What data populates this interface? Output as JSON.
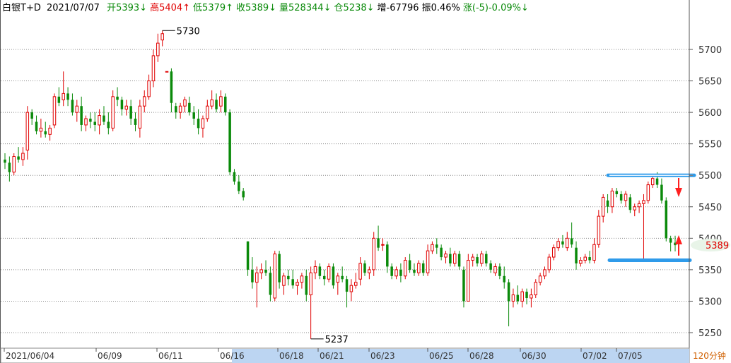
{
  "header": {
    "symbol": "白银T+D",
    "date": "2021/07/07",
    "items": [
      {
        "label": "开",
        "value": "5393",
        "arrow": "↓",
        "color": "#0a8a0a"
      },
      {
        "label": "高",
        "value": "5404",
        "arrow": "↑",
        "color": "#e00000"
      },
      {
        "label": "低",
        "value": "5379",
        "arrow": "↑",
        "color": "#0a8a0a"
      },
      {
        "label": "收",
        "value": "5389",
        "arrow": "↓",
        "color": "#0a8a0a"
      },
      {
        "label": "量",
        "value": "528344",
        "arrow": "↓",
        "color": "#0a8a0a"
      },
      {
        "label": "仓",
        "value": "5238",
        "arrow": "↓",
        "color": "#0a8a0a"
      },
      {
        "label": "增",
        "value": "-67796",
        "arrow": "",
        "color": "#000000"
      },
      {
        "label": "振",
        "value": "0.46%",
        "arrow": "",
        "color": "#000000"
      },
      {
        "label": "涨",
        "value": "(-5)-0.09%",
        "arrow": "↓",
        "color": "#0a8a0a"
      }
    ]
  },
  "chart_data": {
    "type": "candlestick",
    "period": "120分钟",
    "ylim": [
      5215,
      5745
    ],
    "y_ticks": [
      5250,
      5300,
      5350,
      5400,
      5450,
      5500,
      5550,
      5600,
      5650,
      5700
    ],
    "x_tick_labels": [
      "2021/06/04",
      "06/09",
      "06/11",
      "06/16",
      "06/18",
      "06/21",
      "06/23",
      "06/25",
      "06/28",
      "06/30",
      "07/02",
      "07/05"
    ],
    "last_price": "5389",
    "annotations": {
      "high": "5730",
      "low": "5237"
    },
    "resistance_level": 5500,
    "support_level": 5365,
    "colors": {
      "up": "#e00000",
      "down": "#0a8a0a",
      "level_line": "#2f9bea",
      "arrow": "#ff2020"
    },
    "candles": [
      [
        5525,
        5535,
        5510,
        5520
      ],
      [
        5520,
        5530,
        5490,
        5505
      ],
      [
        5505,
        5535,
        5500,
        5530
      ],
      [
        5530,
        5545,
        5520,
        5525
      ],
      [
        5525,
        5545,
        5515,
        5535
      ],
      [
        5540,
        5610,
        5525,
        5600
      ],
      [
        5600,
        5605,
        5580,
        5590
      ],
      [
        5585,
        5595,
        5565,
        5570
      ],
      [
        5570,
        5590,
        5560,
        5575
      ],
      [
        5570,
        5585,
        5560,
        5565
      ],
      [
        5565,
        5580,
        5555,
        5575
      ],
      [
        5580,
        5630,
        5575,
        5625
      ],
      [
        5625,
        5640,
        5610,
        5615
      ],
      [
        5620,
        5665,
        5610,
        5630
      ],
      [
        5630,
        5640,
        5610,
        5620
      ],
      [
        5620,
        5630,
        5595,
        5600
      ],
      [
        5600,
        5620,
        5585,
        5610
      ],
      [
        5610,
        5625,
        5570,
        5580
      ],
      [
        5580,
        5595,
        5570,
        5590
      ],
      [
        5590,
        5600,
        5575,
        5585
      ],
      [
        5585,
        5600,
        5570,
        5580
      ],
      [
        5580,
        5605,
        5565,
        5595
      ],
      [
        5595,
        5610,
        5580,
        5585
      ],
      [
        5585,
        5600,
        5565,
        5575
      ],
      [
        5575,
        5635,
        5570,
        5625
      ],
      [
        5625,
        5640,
        5610,
        5620
      ],
      [
        5620,
        5625,
        5595,
        5605
      ],
      [
        5605,
        5620,
        5595,
        5610
      ],
      [
        5610,
        5620,
        5580,
        5590
      ],
      [
        5590,
        5600,
        5570,
        5580
      ],
      [
        5575,
        5620,
        5560,
        5610
      ],
      [
        5610,
        5635,
        5600,
        5625
      ],
      [
        5625,
        5660,
        5620,
        5650
      ],
      [
        5650,
        5700,
        5640,
        5690
      ],
      [
        5690,
        5725,
        5680,
        5710
      ],
      [
        5715,
        5730,
        5705,
        5725
      ],
      [
        5665,
        5665,
        5665,
        5665
      ],
      [
        5665,
        5670,
        5600,
        5615
      ],
      [
        5610,
        5615,
        5590,
        5600
      ],
      [
        5600,
        5615,
        5590,
        5610
      ],
      [
        5610,
        5625,
        5600,
        5620
      ],
      [
        5615,
        5625,
        5595,
        5600
      ],
      [
        5600,
        5610,
        5580,
        5590
      ],
      [
        5590,
        5605,
        5565,
        5575
      ],
      [
        5575,
        5595,
        5560,
        5590
      ],
      [
        5590,
        5620,
        5585,
        5610
      ],
      [
        5610,
        5635,
        5605,
        5620
      ],
      [
        5620,
        5630,
        5600,
        5605
      ],
      [
        5610,
        5635,
        5600,
        5625
      ],
      [
        5625,
        5630,
        5595,
        5600
      ],
      [
        5600,
        5605,
        5500,
        5505
      ],
      [
        5505,
        5510,
        5485,
        5490
      ],
      [
        5490,
        5500,
        5470,
        5475
      ],
      [
        5475,
        5480,
        5460,
        5465
      ],
      [
        5395,
        5395,
        5340,
        5350
      ],
      [
        5350,
        5370,
        5320,
        5330
      ],
      [
        5330,
        5355,
        5290,
        5345
      ],
      [
        5345,
        5360,
        5335,
        5350
      ],
      [
        5350,
        5365,
        5340,
        5345
      ],
      [
        5345,
        5355,
        5300,
        5310
      ],
      [
        5305,
        5380,
        5300,
        5375
      ],
      [
        5375,
        5380,
        5320,
        5330
      ],
      [
        5325,
        5345,
        5310,
        5340
      ],
      [
        5340,
        5350,
        5325,
        5335
      ],
      [
        5335,
        5350,
        5320,
        5325
      ],
      [
        5325,
        5335,
        5310,
        5330
      ],
      [
        5330,
        5345,
        5320,
        5340
      ],
      [
        5340,
        5350,
        5300,
        5310
      ],
      [
        5310,
        5355,
        5240,
        5345
      ],
      [
        5345,
        5365,
        5335,
        5355
      ],
      [
        5355,
        5360,
        5335,
        5340
      ],
      [
        5340,
        5350,
        5325,
        5335
      ],
      [
        5335,
        5360,
        5330,
        5355
      ],
      [
        5355,
        5360,
        5320,
        5325
      ],
      [
        5330,
        5345,
        5310,
        5340
      ],
      [
        5340,
        5355,
        5330,
        5335
      ],
      [
        5335,
        5340,
        5290,
        5315
      ],
      [
        5315,
        5335,
        5300,
        5325
      ],
      [
        5325,
        5345,
        5320,
        5330
      ],
      [
        5335,
        5370,
        5325,
        5360
      ],
      [
        5360,
        5365,
        5340,
        5345
      ],
      [
        5345,
        5355,
        5335,
        5350
      ],
      [
        5350,
        5410,
        5340,
        5400
      ],
      [
        5400,
        5420,
        5380,
        5385
      ],
      [
        5390,
        5400,
        5380,
        5390
      ],
      [
        5390,
        5395,
        5345,
        5355
      ],
      [
        5355,
        5360,
        5335,
        5340
      ],
      [
        5340,
        5355,
        5335,
        5350
      ],
      [
        5350,
        5360,
        5330,
        5340
      ],
      [
        5340,
        5370,
        5335,
        5365
      ],
      [
        5365,
        5375,
        5345,
        5350
      ],
      [
        5350,
        5360,
        5340,
        5345
      ],
      [
        5345,
        5365,
        5340,
        5360
      ],
      [
        5360,
        5365,
        5340,
        5345
      ],
      [
        5345,
        5390,
        5340,
        5380
      ],
      [
        5380,
        5395,
        5375,
        5390
      ],
      [
        5390,
        5400,
        5375,
        5385
      ],
      [
        5385,
        5390,
        5365,
        5370
      ],
      [
        5370,
        5380,
        5360,
        5375
      ],
      [
        5375,
        5385,
        5355,
        5360
      ],
      [
        5360,
        5380,
        5355,
        5375
      ],
      [
        5375,
        5380,
        5350,
        5355
      ],
      [
        5350,
        5355,
        5290,
        5300
      ],
      [
        5300,
        5375,
        5300,
        5365
      ],
      [
        5365,
        5375,
        5355,
        5370
      ],
      [
        5370,
        5375,
        5355,
        5360
      ],
      [
        5360,
        5380,
        5355,
        5375
      ],
      [
        5375,
        5380,
        5355,
        5360
      ],
      [
        5360,
        5365,
        5345,
        5350
      ],
      [
        5345,
        5360,
        5340,
        5355
      ],
      [
        5355,
        5360,
        5335,
        5340
      ],
      [
        5340,
        5355,
        5320,
        5330
      ],
      [
        5330,
        5335,
        5260,
        5300
      ],
      [
        5300,
        5320,
        5290,
        5310
      ],
      [
        5310,
        5325,
        5295,
        5300
      ],
      [
        5300,
        5320,
        5290,
        5315
      ],
      [
        5315,
        5320,
        5295,
        5305
      ],
      [
        5305,
        5320,
        5290,
        5310
      ],
      [
        5310,
        5335,
        5305,
        5330
      ],
      [
        5330,
        5345,
        5325,
        5340
      ],
      [
        5340,
        5355,
        5335,
        5350
      ],
      [
        5350,
        5375,
        5345,
        5370
      ],
      [
        5370,
        5390,
        5365,
        5385
      ],
      [
        5385,
        5400,
        5380,
        5395
      ],
      [
        5395,
        5405,
        5385,
        5390
      ],
      [
        5385,
        5410,
        5380,
        5400
      ],
      [
        5400,
        5425,
        5385,
        5390
      ],
      [
        5385,
        5395,
        5350,
        5360
      ],
      [
        5360,
        5370,
        5355,
        5365
      ],
      [
        5365,
        5375,
        5360,
        5370
      ],
      [
        5370,
        5380,
        5360,
        5365
      ],
      [
        5365,
        5400,
        5360,
        5390
      ],
      [
        5390,
        5445,
        5385,
        5435
      ],
      [
        5435,
        5470,
        5425,
        5465
      ],
      [
        5460,
        5470,
        5440,
        5450
      ],
      [
        5450,
        5480,
        5440,
        5475
      ],
      [
        5475,
        5480,
        5465,
        5470
      ],
      [
        5470,
        5475,
        5455,
        5460
      ],
      [
        5460,
        5475,
        5450,
        5470
      ],
      [
        5465,
        5470,
        5440,
        5445
      ],
      [
        5445,
        5455,
        5435,
        5450
      ],
      [
        5450,
        5460,
        5440,
        5455
      ],
      [
        5455,
        5470,
        5365,
        5460
      ],
      [
        5460,
        5490,
        5455,
        5485
      ],
      [
        5485,
        5500,
        5480,
        5495
      ],
      [
        5495,
        5505,
        5480,
        5485
      ],
      [
        5485,
        5495,
        5455,
        5460
      ],
      [
        5460,
        5465,
        5395,
        5400
      ],
      [
        5400,
        5404,
        5379,
        5393
      ],
      [
        5393,
        5404,
        5379,
        5389
      ]
    ]
  }
}
